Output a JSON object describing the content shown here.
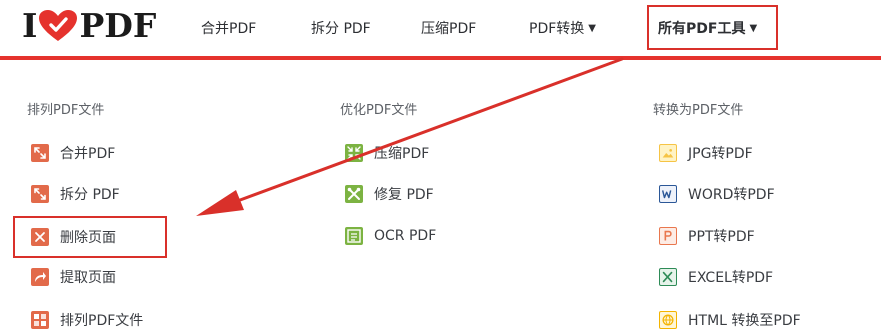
{
  "logo": {
    "letter": "I",
    "word": "PDF"
  },
  "nav": {
    "merge": "合并PDF",
    "split": "拆分 PDF",
    "compress": "压缩PDF",
    "convert": "PDF转换",
    "all_tools": "所有PDF工具"
  },
  "columns": {
    "organize": {
      "heading": "排列PDF文件",
      "items": [
        "合并PDF",
        "拆分 PDF",
        "删除页面",
        "提取页面",
        "排列PDF文件"
      ]
    },
    "optimize": {
      "heading": "优化PDF文件",
      "items": [
        "压缩PDF",
        "修复 PDF",
        "OCR PDF"
      ]
    },
    "convert_to": {
      "heading": "转换为PDF文件",
      "items": [
        "JPG转PDF",
        "WORD转PDF",
        "PPT转PDF",
        "EXCEL转PDF",
        "HTML 转换至PDF"
      ]
    }
  },
  "icons": {
    "organize": [
      "merge-icon",
      "split-icon",
      "delete-pages-icon",
      "extract-pages-icon",
      "organize-pdf-icon"
    ],
    "optimize": [
      "compress-icon",
      "repair-icon",
      "ocr-icon"
    ],
    "convert_to": [
      "jpg-icon",
      "word-icon",
      "ppt-icon",
      "excel-icon",
      "html-icon"
    ]
  },
  "colors": {
    "brand_red": "#e5322d",
    "annotation_red": "#d9302a",
    "organize_icon": "#e26a4a",
    "optimize_icon": "#7cb342",
    "jpg_icon": "#f6c445",
    "word_icon": "#2b5797",
    "ppt_icon": "#e9774e",
    "excel_icon": "#2e8b57",
    "html_icon": "#f4b400"
  }
}
